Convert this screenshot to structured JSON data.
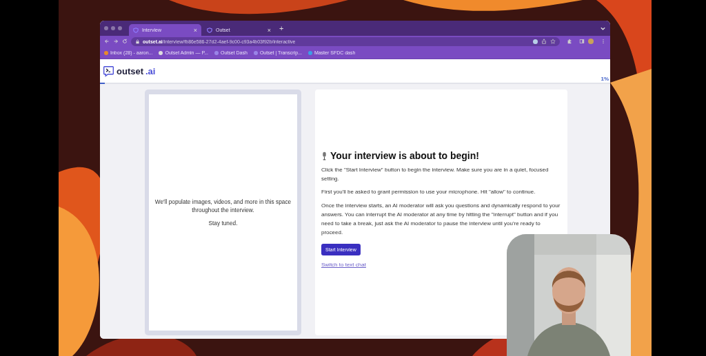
{
  "browser": {
    "tabs": [
      {
        "label": "Interview",
        "selected": true,
        "close": "×"
      },
      {
        "label": "Outset",
        "selected": false,
        "close": "×"
      }
    ],
    "new_tab": "+",
    "url": {
      "host": "outset.ai",
      "path": "/interview/fb86e586-27d2-4aef-9c00-c93a4b03f92b/interactive"
    },
    "bookmarks": [
      {
        "label": "Inbox (28) - aaron..."
      },
      {
        "label": "Outset Admin — P..."
      },
      {
        "label": "Outset Dash"
      },
      {
        "label": "Outset | Transcrip..."
      },
      {
        "label": "Master SFDC dash"
      }
    ]
  },
  "app": {
    "logo": {
      "name": "outset",
      "suffix": ".ai"
    },
    "progress": {
      "level": 0.01,
      "reading": "1%"
    },
    "media_panel": {
      "lines": [
        "We'll populate images, videos, and more in this space throughout the interview.",
        "Stay tuned."
      ]
    },
    "intro": {
      "title": "Your interview is about to begin!",
      "paragraphs": [
        "Click the \"Start Interview\" button to begin the interview. Make sure you are in a quiet, focused setting.",
        "First you'll be asked to grant permission to use your microphone. Hit \"allow\" to continue.",
        "Once the interview starts, an AI moderator will ask you questions and dynamically respond to your answers. You can interrupt the AI moderator at any time by hitting the \"interrupt\" button and if you need to take a break, just ask the AI moderator to pause the interview until you're ready to proceed."
      ],
      "button": "Start Interview",
      "link": "Switch to text chat"
    }
  }
}
